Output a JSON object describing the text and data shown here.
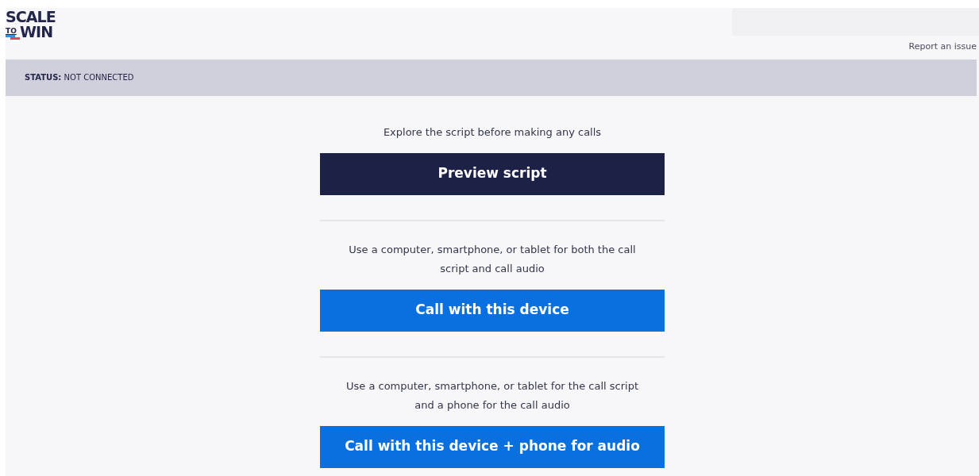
{
  "logo": {
    "line1": "SCALE",
    "small": "TO",
    "line2": "WIN"
  },
  "header": {
    "report_link": "Report an issue"
  },
  "status_bar": {
    "text": "**STATUS:** NOT CONNECTED"
  },
  "options": [
    {
      "description": "Explore the script before making any calls",
      "button": "Preview script",
      "kind": "dark"
    },
    {
      "description": "Use a computer, smartphone, or tablet for both the call script and call audio",
      "button": "Call with this device",
      "kind": "primary"
    },
    {
      "description": "Use a computer, smartphone, or tablet for the call script and a phone for the call audio",
      "button": "Call with this device + phone for audio",
      "kind": "primary"
    }
  ]
}
